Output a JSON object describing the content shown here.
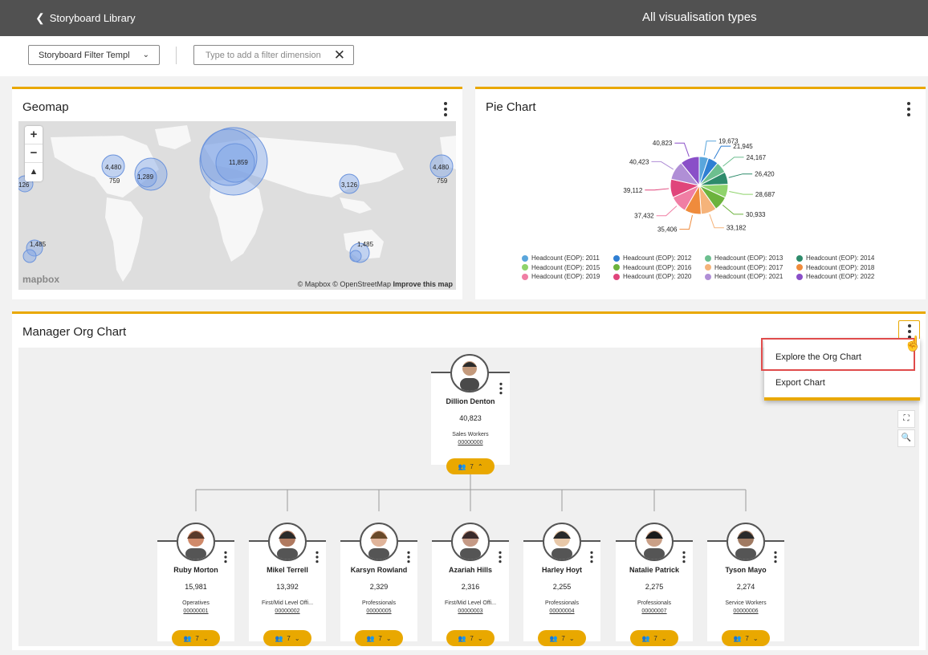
{
  "header": {
    "back_label": "Storyboard Library",
    "title": "All visualisation types"
  },
  "filters": {
    "select_value": "Storyboard Filter Templ",
    "input_placeholder": "Type to add a filter dimension"
  },
  "geomap": {
    "title": "Geomap",
    "bubbles": [
      {
        "label": "11,859"
      },
      {
        "label": "4,480"
      },
      {
        "label": "759"
      },
      {
        "label": "1,289"
      },
      {
        "label": "3,126"
      },
      {
        "label": "4,480"
      },
      {
        "label": "759"
      },
      {
        "label": "1,485"
      },
      {
        "label": "1,485"
      },
      {
        "label": "126"
      }
    ],
    "logo": "mapbox",
    "attribution": "© Mapbox © OpenStreetMap",
    "improve": "Improve this map"
  },
  "pie": {
    "title": "Pie Chart",
    "chart_data": {
      "type": "pie",
      "slices": [
        {
          "label": "Headcount (EOP): 2011",
          "value": 19673,
          "color": "#5aa6dc"
        },
        {
          "label": "Headcount (EOP): 2012",
          "value": 21945,
          "color": "#2f7fd3"
        },
        {
          "label": "Headcount (EOP): 2013",
          "value": 24167,
          "color": "#6cbf8f"
        },
        {
          "label": "Headcount (EOP): 2014",
          "value": 26420,
          "color": "#2e8b6b"
        },
        {
          "label": "Headcount (EOP): 2015",
          "value": 28687,
          "color": "#8fd36b"
        },
        {
          "label": "Headcount (EOP): 2016",
          "value": 30933,
          "color": "#6cb33d"
        },
        {
          "label": "Headcount (EOP): 2017",
          "value": 33182,
          "color": "#f5b37a"
        },
        {
          "label": "Headcount (EOP): 2018",
          "value": 35406,
          "color": "#ef8b3c"
        },
        {
          "label": "Headcount (EOP): 2019",
          "value": 37432,
          "color": "#f07ea4"
        },
        {
          "label": "Headcount (EOP): 2020",
          "value": 39112,
          "color": "#e0457b"
        },
        {
          "label": "Headcount (EOP): 2021",
          "value": 40423,
          "color": "#b08fd6"
        },
        {
          "label": "Headcount (EOP): 2022",
          "value": 40823,
          "color": "#8a4fc8"
        }
      ],
      "value_labels": [
        "19,673",
        "21,945",
        "24,167",
        "26,420",
        "28,687",
        "30,933",
        "33,182",
        "35,406",
        "37,432",
        "39,112",
        "40,423",
        "40,823"
      ]
    }
  },
  "org": {
    "title": "Manager Org Chart",
    "root": {
      "name": "Dillion Denton",
      "value": "40,823",
      "role": "Sales Workers",
      "id": "00000000",
      "count": "7"
    },
    "children": [
      {
        "name": "Ruby Morton",
        "value": "15,981",
        "role": "Operatives",
        "id": "00000001",
        "count": "7"
      },
      {
        "name": "Mikel Terrell",
        "value": "13,392",
        "role": "First/Mid Level Offi...",
        "id": "00000002",
        "count": "7"
      },
      {
        "name": "Karsyn Rowland",
        "value": "2,329",
        "role": "Professionals",
        "id": "00000005",
        "count": "7"
      },
      {
        "name": "Azariah Hills",
        "value": "2,316",
        "role": "First/Mid Level Offi...",
        "id": "00000003",
        "count": "7"
      },
      {
        "name": "Harley Hoyt",
        "value": "2,255",
        "role": "Professionals",
        "id": "00000004",
        "count": "7"
      },
      {
        "name": "Natalie Patrick",
        "value": "2,275",
        "role": "Professionals",
        "id": "00000007",
        "count": "7"
      },
      {
        "name": "Tyson Mayo",
        "value": "2,274",
        "role": "Service Workers",
        "id": "00000006",
        "count": "7"
      }
    ],
    "menu": {
      "explore": "Explore the Org Chart",
      "export": "Export Chart"
    }
  }
}
